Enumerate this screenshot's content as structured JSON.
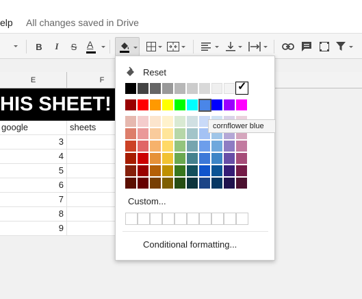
{
  "menubar": {
    "help_label": "elp",
    "save_status": "All changes saved in Drive"
  },
  "toolbar": {
    "bold_label": "B",
    "italic_label": "I",
    "strike_label": "S",
    "text_color_label": "A",
    "text_color": "#000000"
  },
  "sheet": {
    "columns": [
      "E",
      "F"
    ],
    "title_text": "HIS SHEET!",
    "header_row": [
      "google",
      "sheets"
    ],
    "values": [
      "3",
      "4",
      "5",
      "6",
      "7",
      "8",
      "9"
    ]
  },
  "palette": {
    "reset_label": "Reset",
    "custom_label": "Custom...",
    "conditional_label": "Conditional formatting...",
    "selected_color": "cornflower blue",
    "checked_mark": "✓",
    "grays": [
      "#000000",
      "#434343",
      "#666666",
      "#999999",
      "#b7b7b7",
      "#cccccc",
      "#d9d9d9",
      "#efefef",
      "#f3f3f3",
      "#ffffff"
    ],
    "brights": [
      "#980000",
      "#ff0000",
      "#ff9900",
      "#ffff00",
      "#00ff00",
      "#00ffff",
      "#4a86e8",
      "#0000ff",
      "#9900ff",
      "#ff00ff"
    ],
    "shades": [
      [
        "#e6b8af",
        "#f4cccc",
        "#fce5cd",
        "#fff2cc",
        "#d9ead3",
        "#d0e0e3",
        "#c9daf8",
        "#cfe2f3",
        "#d9d2e9",
        "#ead1dc"
      ],
      [
        "#dd7e6b",
        "#ea9999",
        "#f9cb9c",
        "#ffe599",
        "#b6d7a8",
        "#a2c4c9",
        "#a4c2f4",
        "#9fc5e8",
        "#b4a7d6",
        "#d5a6bd"
      ],
      [
        "#cc4125",
        "#e06666",
        "#f6b26b",
        "#ffd966",
        "#93c47d",
        "#76a5af",
        "#6d9eeb",
        "#6fa8dc",
        "#8e7cc3",
        "#c27ba0"
      ],
      [
        "#a61c00",
        "#cc0000",
        "#e69138",
        "#f1c232",
        "#6aa84f",
        "#45818e",
        "#3c78d8",
        "#3d85c6",
        "#674ea7",
        "#a64d79"
      ],
      [
        "#85200c",
        "#990000",
        "#b45f06",
        "#bf9000",
        "#38761d",
        "#134f5c",
        "#1155cc",
        "#0b5394",
        "#351c75",
        "#741b47"
      ],
      [
        "#5b0f00",
        "#660000",
        "#783f04",
        "#7f6000",
        "#274e13",
        "#0c343d",
        "#1c4587",
        "#073763",
        "#20124d",
        "#4c1130"
      ]
    ]
  }
}
